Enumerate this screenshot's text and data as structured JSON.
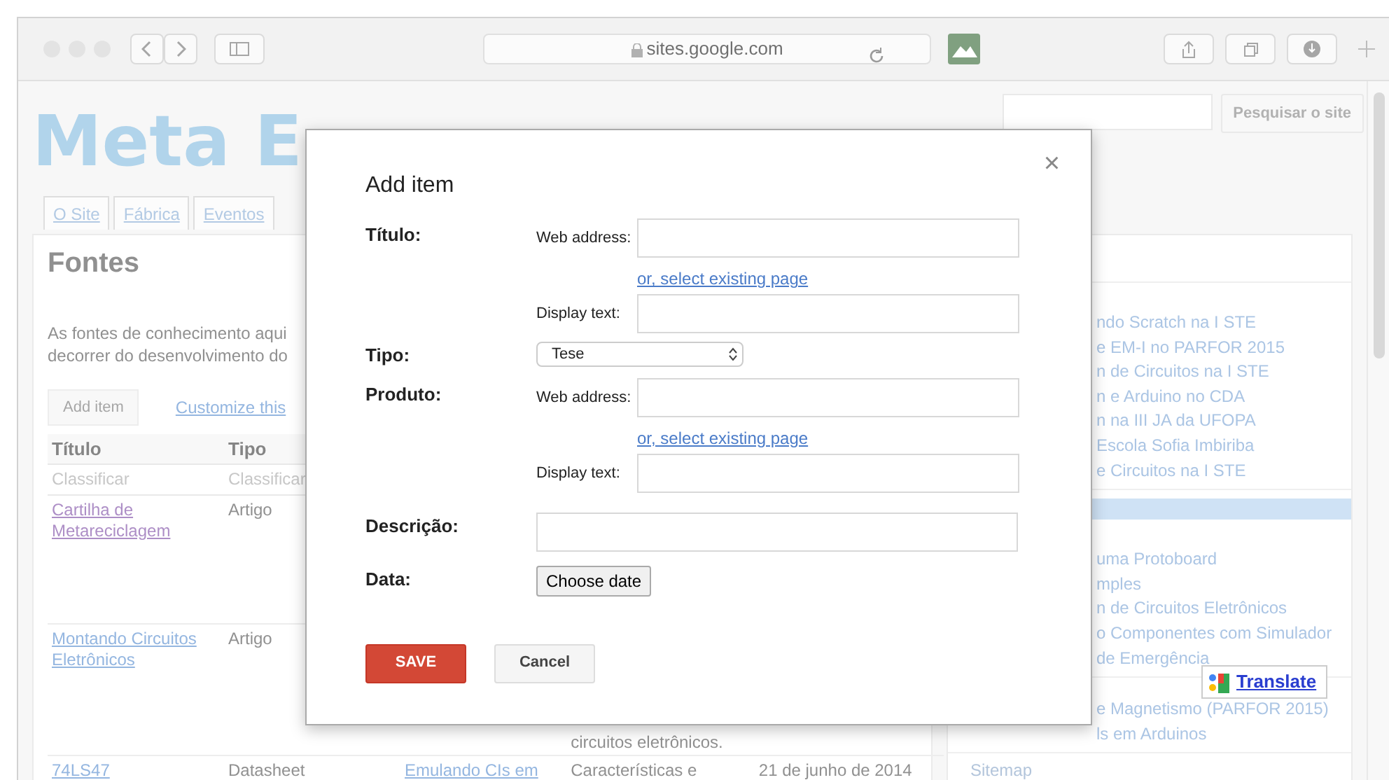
{
  "browser": {
    "url": "sites.google.com"
  },
  "site": {
    "logo": "Meta E",
    "search_button": "Pesquisar o site",
    "tabs": [
      {
        "label": "O Site"
      },
      {
        "label": "Fábrica"
      },
      {
        "label": "Eventos"
      }
    ]
  },
  "content": {
    "heading": "Fontes",
    "paragraph_lines": [
      "As fontes de conhecimento aqui",
      "decorrer do desenvolvimento do"
    ],
    "add_button": "Add item",
    "customize_link": "Customize this",
    "table": {
      "columns": [
        "Título",
        "Tipo"
      ],
      "sort_labels": [
        "Classificar",
        "Classificar"
      ],
      "rows": [
        {
          "cells": [
            {
              "text": "Cartilha de Metareciclagem",
              "kind": "visited"
            },
            {
              "text": "Artigo",
              "kind": "text"
            }
          ]
        },
        {
          "cells": [
            {
              "text": "Montando Circuitos Eletrônicos",
              "kind": "link"
            },
            {
              "text": "Artigo",
              "kind": "text"
            },
            {
              "kind": "empty"
            },
            {
              "text": "circuitos eletrônicos.",
              "kind": "tail"
            }
          ]
        },
        {
          "cells": [
            {
              "text": "74LS47",
              "kind": "link"
            },
            {
              "text": "Datasheet",
              "kind": "text"
            },
            {
              "text": "Emulando CIs em",
              "kind": "link"
            },
            {
              "text": "Características e",
              "kind": "text"
            },
            {
              "text": "21 de junho de 2014",
              "kind": "text"
            }
          ]
        }
      ]
    }
  },
  "sidebar": {
    "sections": [
      {
        "items": [
          "ndo Scratch na I STE",
          "e EM-I no PARFOR 2015",
          "n de Circuitos na I STE",
          "n e Arduino no CDA",
          "n na III JA da UFOPA",
          "Escola Sofia Imbiriba",
          "e Circuitos na I STE"
        ]
      },
      {
        "items": [
          "uma Protoboard",
          "mples",
          "n de Circuitos Eletrônicos",
          "o Componentes com Simulador",
          "de Emergência"
        ]
      },
      {
        "items": [
          "e Magnetismo (PARFOR 2015)",
          "ls em Arduinos"
        ]
      }
    ],
    "sitemap": "Sitemap",
    "translate": "Translate"
  },
  "dialog": {
    "title": "Add item",
    "close": "×",
    "rows": [
      {
        "label": "Título:",
        "kind": "link",
        "web_address_label": "Web address:",
        "select_link": "or, select existing page",
        "display_text_label": "Display text:"
      },
      {
        "label": "Tipo:",
        "kind": "select",
        "value": "Tese"
      },
      {
        "label": "Produto:",
        "kind": "link",
        "web_address_label": "Web address:",
        "select_link": "or, select existing page",
        "display_text_label": "Display text:"
      },
      {
        "label": "Descrição:",
        "kind": "text"
      },
      {
        "label": "Data:",
        "kind": "date",
        "button": "Choose date"
      }
    ],
    "save": "SAVE",
    "cancel": "Cancel"
  }
}
